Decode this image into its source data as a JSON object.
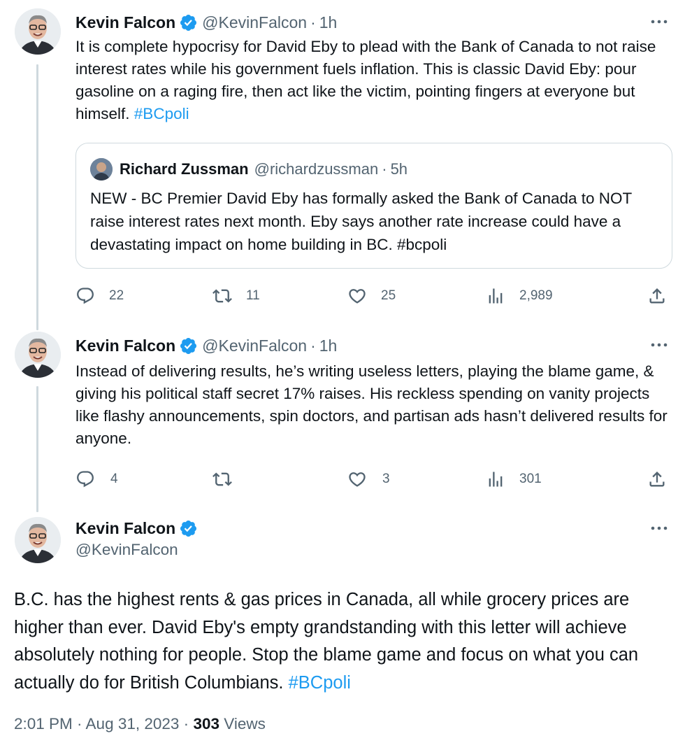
{
  "colors": {
    "link": "#1d9bf0",
    "muted": "#536471",
    "text": "#0f1419",
    "verified": "#1d9bf0",
    "border": "#cfd9de"
  },
  "tweets": [
    {
      "name": "Kevin Falcon",
      "handle": "@KevinFalcon",
      "separator": "·",
      "time": "1h",
      "text": "It is complete hypocrisy for David Eby to plead with the Bank of Canada to not raise interest rates while his government fuels inflation. This is classic David Eby: pour gasoline on a raging fire, then act like the victim, pointing fingers at everyone but himself.",
      "hashtag": "#BCpoli",
      "quote": {
        "name": "Richard Zussman",
        "handle": "@richardzussman",
        "separator": "·",
        "time": "5h",
        "text": "NEW - BC Premier David Eby has formally asked the Bank of Canada to NOT raise interest rates next month. Eby says another rate increase could have a devastating impact on home building in BC. #bcpoli"
      },
      "actions": {
        "replies": "22",
        "retweets": "11",
        "likes": "25",
        "views": "2,989"
      }
    },
    {
      "name": "Kevin Falcon",
      "handle": "@KevinFalcon",
      "separator": "·",
      "time": "1h",
      "text": "Instead of delivering results, he’s writing useless letters, playing the blame game, & giving his political staff secret 17% raises. His reckless spending on vanity projects like flashy announcements, spin doctors, and partisan ads hasn’t delivered results for anyone.",
      "actions": {
        "replies": "4",
        "retweets": "",
        "likes": "3",
        "views": "301"
      }
    }
  ],
  "main_tweet": {
    "name": "Kevin Falcon",
    "handle": "@KevinFalcon",
    "text": "B.C. has the highest rents & gas prices in Canada, all while grocery prices are higher than ever. David Eby's empty grandstanding with this letter will achieve absolutely nothing for people. Stop the blame game and focus on what you can actually do for British Columbians.",
    "hashtag": "#BCpoli",
    "timestamp": "2:01 PM · Aug 31, 2023 ·",
    "views_count": "303",
    "views_label": "Views"
  },
  "icons": [
    "more-icon",
    "verified-badge-icon",
    "reply-icon",
    "retweet-icon",
    "like-icon",
    "views-icon",
    "share-icon"
  ]
}
